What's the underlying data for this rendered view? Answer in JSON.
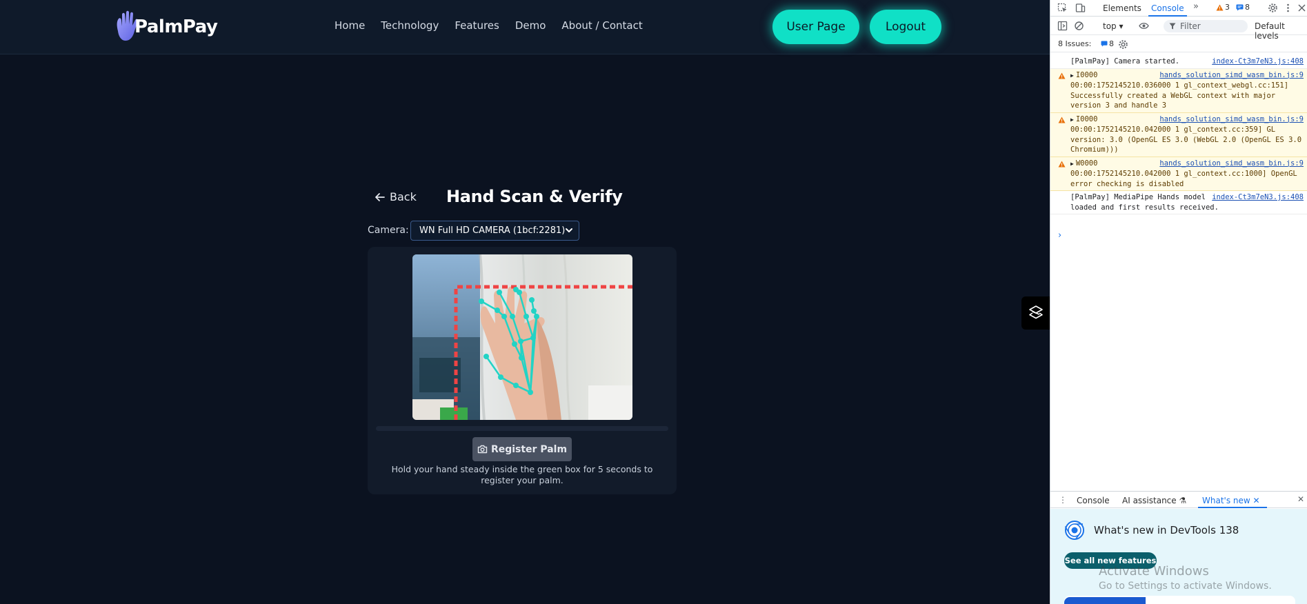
{
  "app": {
    "brand": "PalmPay",
    "nav": [
      "Home",
      "Technology",
      "Features",
      "Demo",
      "About / Contact"
    ],
    "user_page_label": "User Page",
    "logout_label": "Logout",
    "back_label": "Back",
    "title": "Hand Scan & Verify",
    "camera_label": "Camera:",
    "camera_selected": "WN Full HD CAMERA (1bcf:2281)",
    "register_label": "Register Palm",
    "hint": "Hold your hand steady inside the green box for 5 seconds to register your palm.",
    "scan_progress": 0
  },
  "devtools": {
    "tabs": [
      "Elements",
      "Console"
    ],
    "warnings_count": "3",
    "messages_count": "8",
    "context": "top",
    "filter_placeholder": "Filter",
    "levels": "Default levels",
    "issues_label": "8 Issues:",
    "issues_count": "8",
    "log": [
      {
        "type": "info",
        "text": "[PalmPay] Camera started.",
        "source": "index-Ct3m7eN3.js:408"
      },
      {
        "type": "warn",
        "text": "I0000 00:00:1752145210.036000       1 gl_context_webgl.cc:151] Successfully created a WebGL context with major version 3 and handle 3",
        "source": "hands_solution_simd_wasm_bin.js:9"
      },
      {
        "type": "warn",
        "text": "I0000 00:00:1752145210.042000       1 gl_context.cc:359] GL version: 3.0 (OpenGL ES 3.0 (WebGL 2.0 (OpenGL ES 3.0 Chromium)))",
        "source": "hands_solution_simd_wasm_bin.js:9"
      },
      {
        "type": "warn",
        "text": "W0000 00:00:1752145210.042000       1 gl_context.cc:1000] OpenGL error checking is disabled",
        "source": "hands_solution_simd_wasm_bin.js:9"
      },
      {
        "type": "info",
        "text": "[PalmPay] MediaPipe Hands model loaded and first results received.",
        "source": "index-Ct3m7eN3.js:408"
      }
    ],
    "drawer_tabs": [
      "Console",
      "AI assistance",
      "What's new"
    ],
    "whats_new_title": "What's new in DevTools 138",
    "see_features_label": "See all new features"
  },
  "os_watermark": {
    "title": "Activate Windows",
    "subtitle": "Go to Settings to activate Windows."
  },
  "colors": {
    "accent": "#10e0c6",
    "background": "#0b1220",
    "hand_skeleton": "#22d3c5",
    "scan_box": "#ef4444"
  }
}
